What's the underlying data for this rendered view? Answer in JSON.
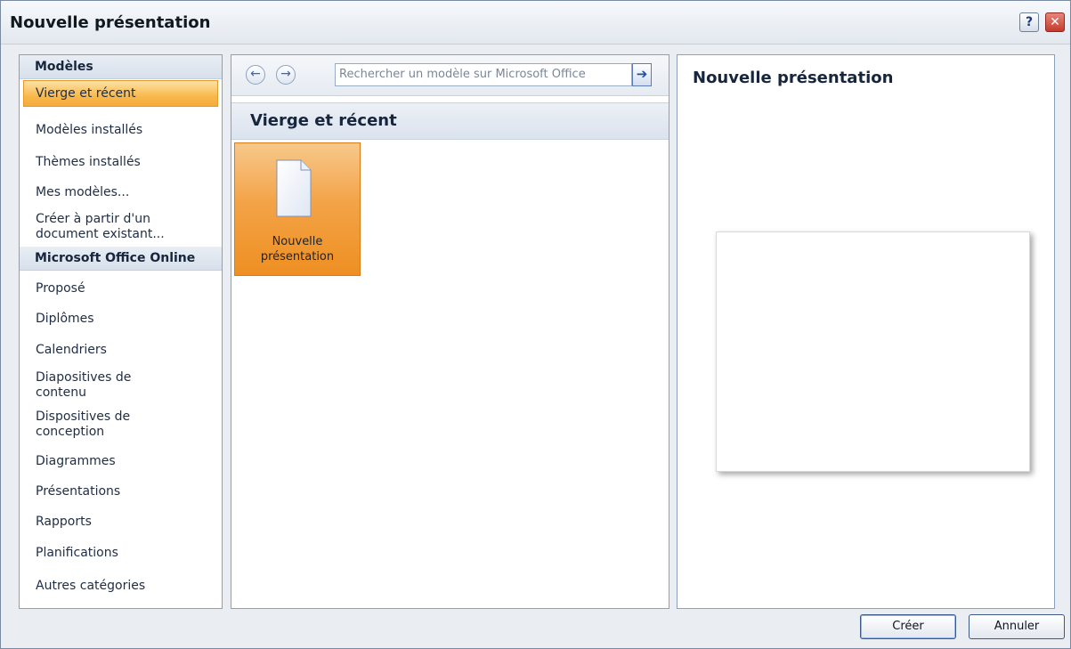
{
  "window": {
    "title": "Nouvelle présentation",
    "help_glyph": "?",
    "close_glyph": "✕"
  },
  "sidebar": {
    "sections": [
      {
        "label": "Modèles"
      },
      {
        "label": "Microsoft Office Online"
      }
    ],
    "items": [
      {
        "label": "Vierge et récent",
        "selected": true
      },
      {
        "label": "Modèles installés"
      },
      {
        "label": "Thèmes installés"
      },
      {
        "label": "Mes modèles..."
      },
      {
        "label": "Créer à partir d'un\ndocument existant..."
      },
      {
        "label": "Proposé"
      },
      {
        "label": "Diplômes"
      },
      {
        "label": "Calendriers"
      },
      {
        "label": "Diapositives de\ncontenu"
      },
      {
        "label": "Dispositives de\nconception"
      },
      {
        "label": "Diagrammes"
      },
      {
        "label": "Présentations"
      },
      {
        "label": "Rapports"
      },
      {
        "label": "Planifications"
      },
      {
        "label": "Autres catégories"
      }
    ]
  },
  "toolbar": {
    "back_glyph": "←",
    "forward_glyph": "→",
    "search_placeholder": "Rechercher un modèle sur Microsoft Office",
    "go_glyph": "➔"
  },
  "middle": {
    "header": "Vierge et récent",
    "tiles": [
      {
        "label": "Nouvelle\nprésentation",
        "selected": true
      }
    ]
  },
  "preview": {
    "title": "Nouvelle présentation"
  },
  "buttons": {
    "create": "Créer",
    "cancel": "Annuler"
  }
}
